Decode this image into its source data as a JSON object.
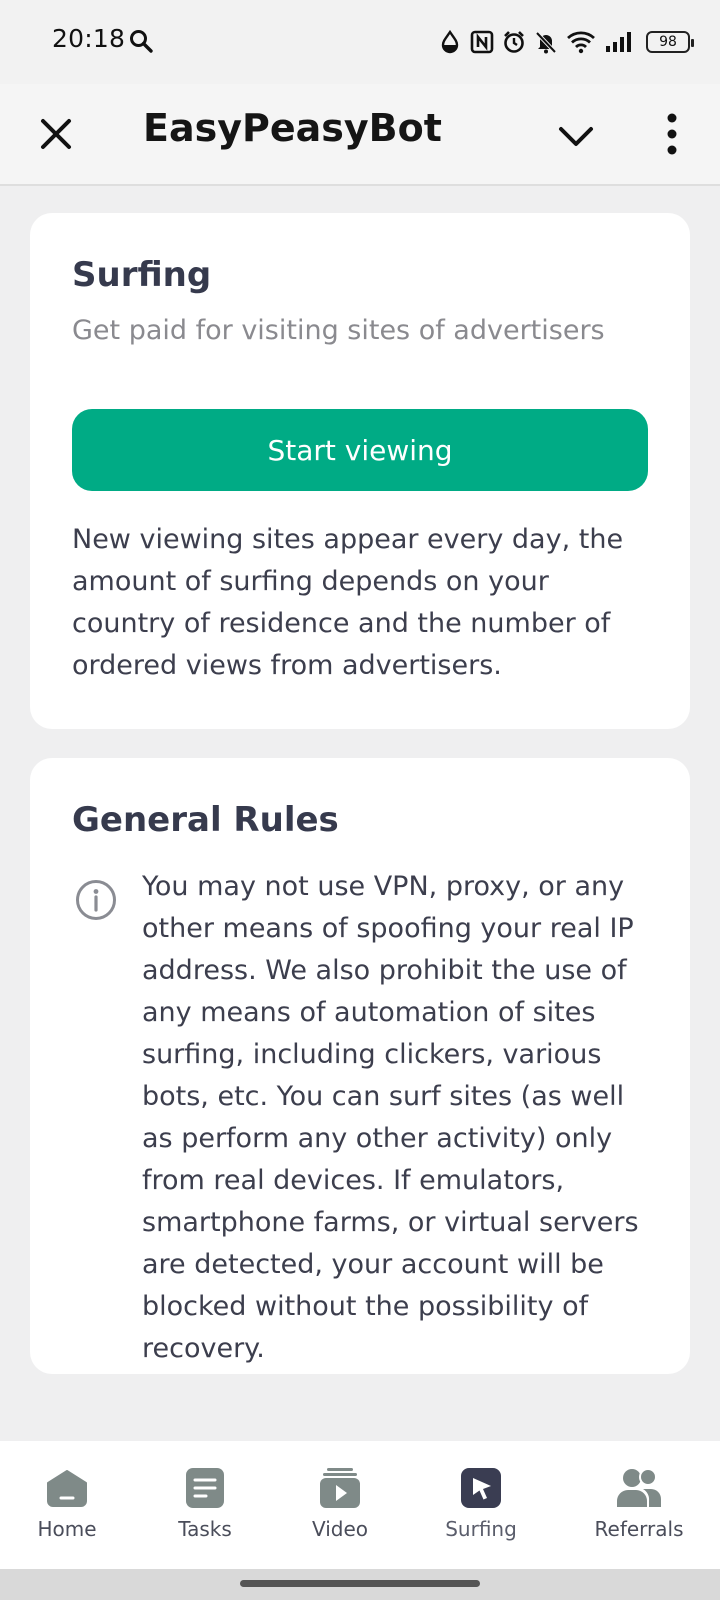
{
  "status_bar": {
    "time": "20:18",
    "battery": "98"
  },
  "app_bar": {
    "title": "EasyPeasyBot"
  },
  "surfing_card": {
    "title": "Surfing",
    "subtitle": "Get paid for visiting sites of advertisers",
    "button_label": "Start viewing",
    "description": "New viewing sites appear every day, the amount of surfing depends on your country of residence and the number of ordered views from advertisers."
  },
  "rules_card": {
    "title": "General Rules",
    "text": "You may not use VPN, proxy, or any other means of spoofing your real IP address. We also prohibit the use of any means of automation of sites surfing, including clickers, various bots, etc. You can surf sites (as well as perform any other activity) only from real devices. If emulators, smartphone farms, or virtual servers are detected, your account will be blocked without the possibility of recovery."
  },
  "bottom_nav": {
    "items": [
      {
        "label": "Home",
        "icon": "home-icon"
      },
      {
        "label": "Tasks",
        "icon": "tasks-icon"
      },
      {
        "label": "Video",
        "icon": "video-icon"
      },
      {
        "label": "Surfing",
        "icon": "cursor-icon",
        "active": true
      },
      {
        "label": "Referrals",
        "icon": "referrals-icon"
      }
    ]
  },
  "colors": {
    "accent": "#00ab85",
    "active_nav": "#3a3d52",
    "inactive_nav": "#7f8a88"
  }
}
